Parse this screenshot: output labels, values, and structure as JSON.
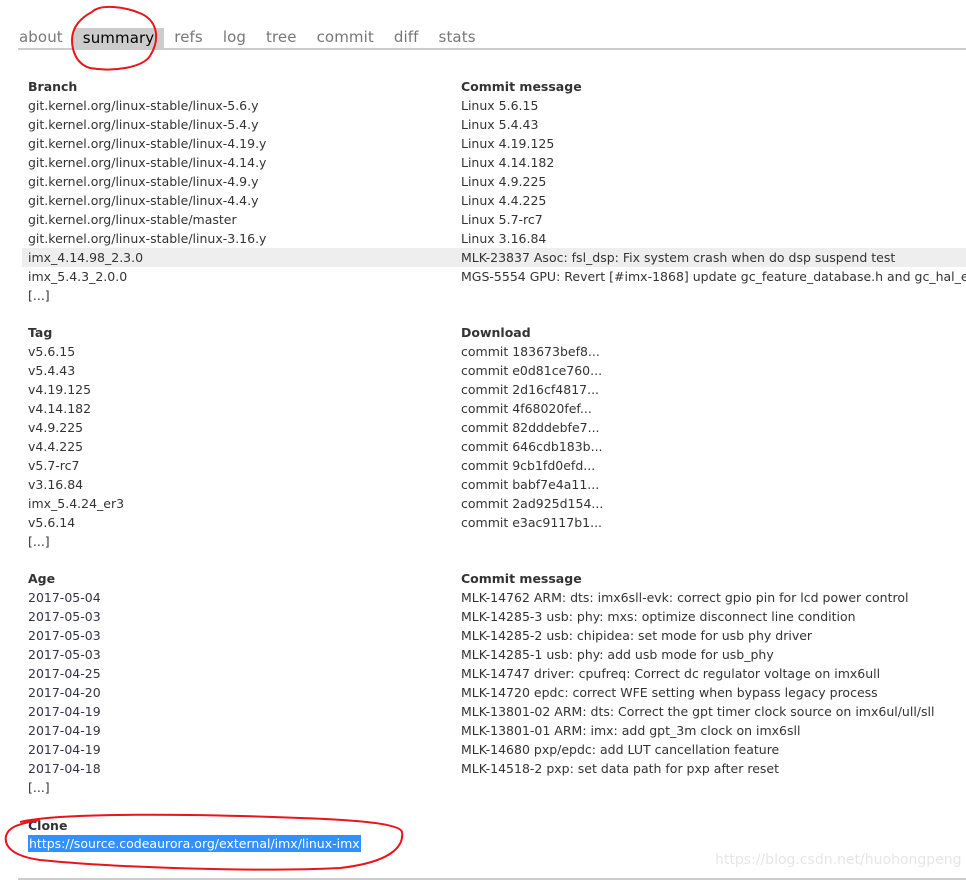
{
  "tabs": [
    {
      "label": "about",
      "active": false
    },
    {
      "label": "summary",
      "active": true
    },
    {
      "label": "refs",
      "active": false
    },
    {
      "label": "log",
      "active": false
    },
    {
      "label": "tree",
      "active": false
    },
    {
      "label": "commit",
      "active": false
    },
    {
      "label": "diff",
      "active": false
    },
    {
      "label": "stats",
      "active": false
    }
  ],
  "branches": {
    "header_left": "Branch",
    "header_right": "Commit message",
    "rows": [
      {
        "branch": "git.kernel.org/linux-stable/linux-5.6.y",
        "message": "Linux 5.6.15"
      },
      {
        "branch": "git.kernel.org/linux-stable/linux-5.4.y",
        "message": "Linux 5.4.43"
      },
      {
        "branch": "git.kernel.org/linux-stable/linux-4.19.y",
        "message": "Linux 4.19.125"
      },
      {
        "branch": "git.kernel.org/linux-stable/linux-4.14.y",
        "message": "Linux 4.14.182"
      },
      {
        "branch": "git.kernel.org/linux-stable/linux-4.9.y",
        "message": "Linux 4.9.225"
      },
      {
        "branch": "git.kernel.org/linux-stable/linux-4.4.y",
        "message": "Linux 4.4.225"
      },
      {
        "branch": "git.kernel.org/linux-stable/master",
        "message": "Linux 5.7-rc7"
      },
      {
        "branch": "git.kernel.org/linux-stable/linux-3.16.y",
        "message": "Linux 3.16.84"
      },
      {
        "branch": "imx_4.14.98_2.3.0",
        "message": "MLK-23837 Asoc: fsl_dsp: Fix system crash when do dsp suspend test",
        "highlighted": true
      },
      {
        "branch": "imx_5.4.3_2.0.0",
        "message": "MGS-5554 GPU: Revert [#imx-1868] update gc_feature_database.h and gc_hal_e"
      }
    ],
    "more": "[...]"
  },
  "tags": {
    "header_left": "Tag",
    "header_right": "Download",
    "rows": [
      {
        "tag": "v5.6.15",
        "download": "commit 183673bef8..."
      },
      {
        "tag": "v5.4.43",
        "download": "commit e0d81ce760..."
      },
      {
        "tag": "v4.19.125",
        "download": "commit 2d16cf4817..."
      },
      {
        "tag": "v4.14.182",
        "download": "commit 4f68020fef..."
      },
      {
        "tag": "v4.9.225",
        "download": "commit 82dddebfe7..."
      },
      {
        "tag": "v4.4.225",
        "download": "commit 646cdb183b..."
      },
      {
        "tag": "v5.7-rc7",
        "download": "commit 9cb1fd0efd..."
      },
      {
        "tag": "v3.16.84",
        "download": "commit babf7e4a11..."
      },
      {
        "tag": "imx_5.4.24_er3",
        "download": "commit 2ad925d154..."
      },
      {
        "tag": "v5.6.14",
        "download": "commit e3ac9117b1..."
      }
    ],
    "more": "[...]"
  },
  "log": {
    "header_left": "Age",
    "header_right": "Commit message",
    "rows": [
      {
        "age": "2017-05-04",
        "message": "MLK-14762 ARM: dts: imx6sll-evk: correct gpio pin for lcd power control"
      },
      {
        "age": "2017-05-03",
        "message": "MLK-14285-3 usb: phy: mxs: optimize disconnect line condition"
      },
      {
        "age": "2017-05-03",
        "message": "MLK-14285-2 usb: chipidea: set mode for usb phy driver"
      },
      {
        "age": "2017-05-03",
        "message": "MLK-14285-1 usb: phy: add usb mode for usb_phy"
      },
      {
        "age": "2017-04-25",
        "message": "MLK-14747 driver: cpufreq: Correct dc regulator voltage on imx6ull"
      },
      {
        "age": "2017-04-20",
        "message": "MLK-14720 epdc: correct WFE setting when bypass legacy process"
      },
      {
        "age": "2017-04-19",
        "message": "MLK-13801-02 ARM: dts: Correct the gpt timer clock source on imx6ul/ull/sll"
      },
      {
        "age": "2017-04-19",
        "message": "MLK-13801-01 ARM: imx: add gpt_3m clock on imx6sll"
      },
      {
        "age": "2017-04-19",
        "message": "MLK-14680 pxp/epdc: add LUT cancellation feature"
      },
      {
        "age": "2017-04-18",
        "message": "MLK-14518-2 pxp: set data path for pxp after reset"
      }
    ],
    "more": "[...]"
  },
  "clone": {
    "header": "Clone",
    "url": "https://source.codeaurora.org/external/imx/linux-imx"
  },
  "watermark": "https://blog.csdn.net/huohongpeng",
  "colors": {
    "annotation": "#e8151b",
    "selection": "#3390ff",
    "active_tab": "#cccccc",
    "row_highlight": "#eeeeee"
  }
}
